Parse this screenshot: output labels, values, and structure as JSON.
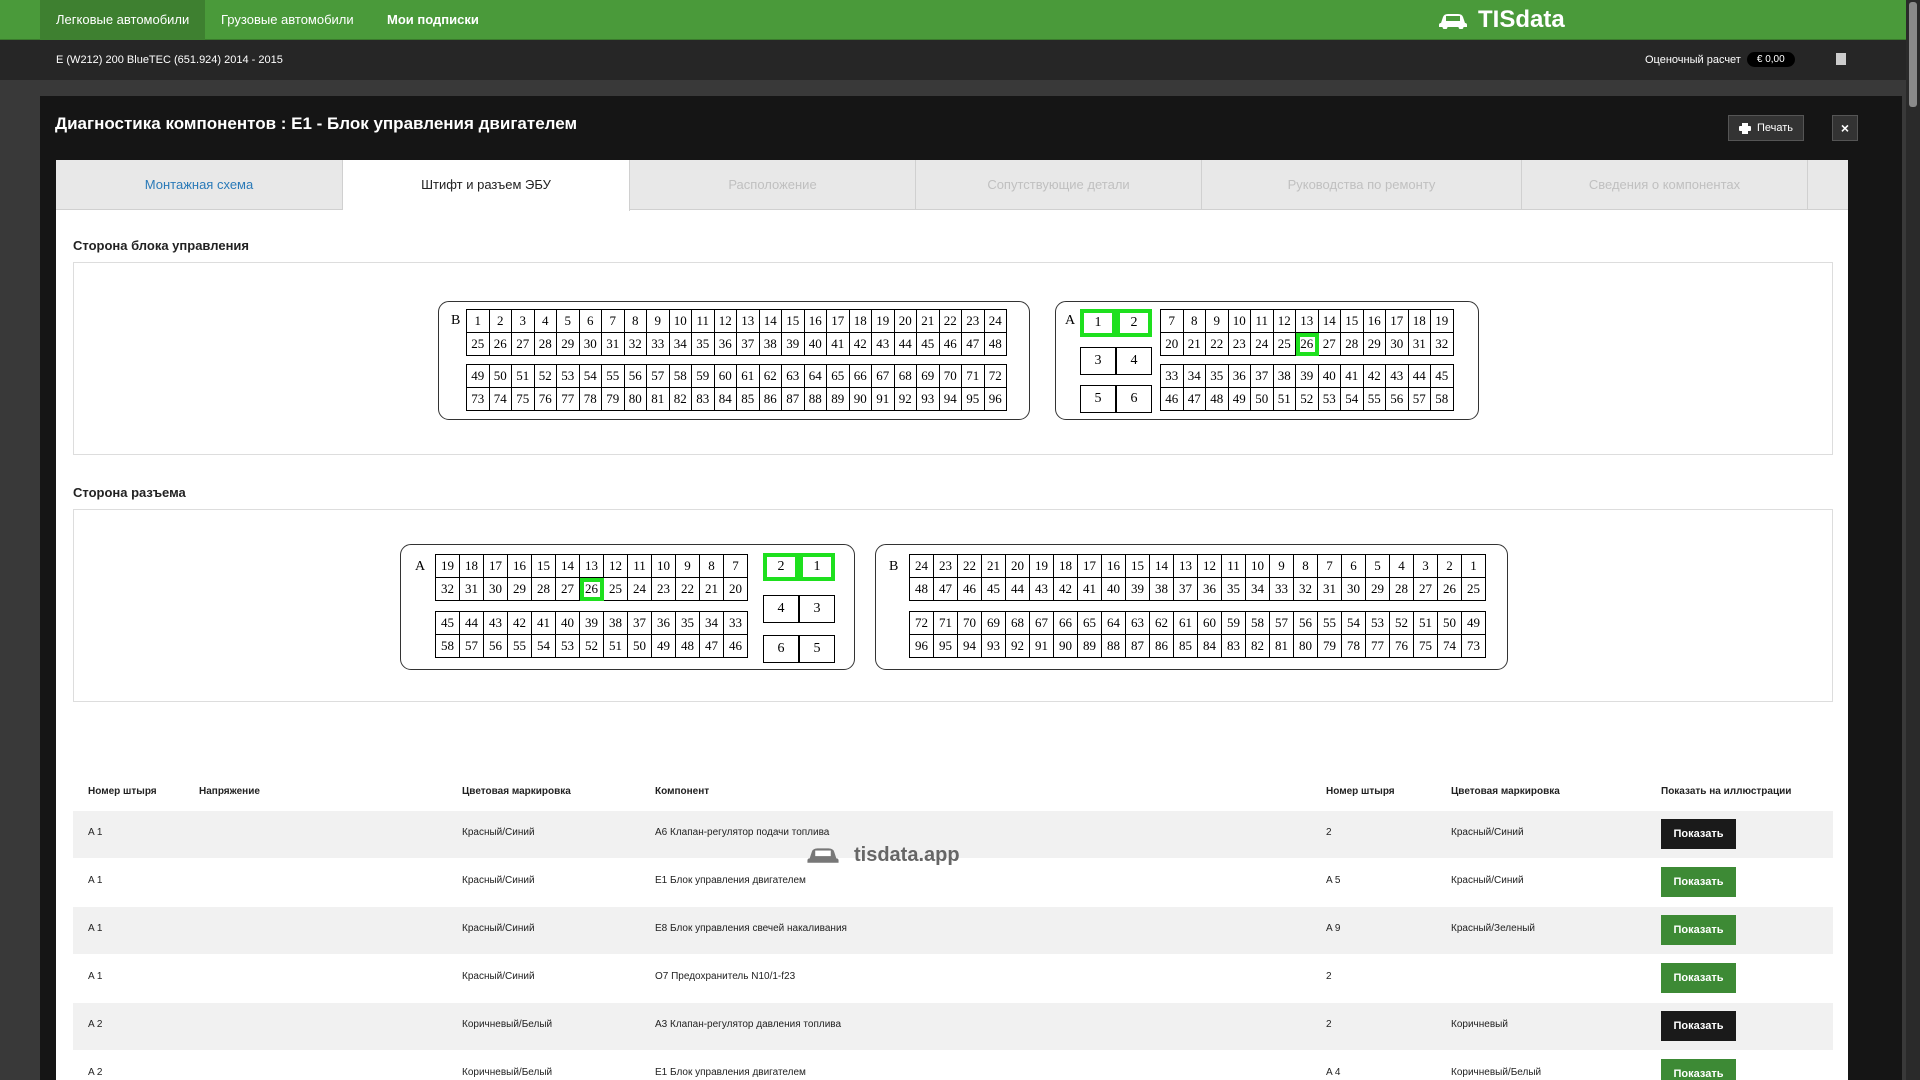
{
  "topnav": {
    "items": [
      {
        "label": "Легковые автомобили",
        "active": true
      },
      {
        "label": "Грузовые автомобили",
        "active": false
      },
      {
        "label": "Мои подписки",
        "active": false
      }
    ],
    "brand": "TISdata",
    "brand_icon": "car-icon"
  },
  "subbar": {
    "vehicle": "E (W212) 200 BlueTEC (651.924) 2014 - 2015",
    "estimate_label": "Оценочный расчет",
    "estimate_value": "€  0,00",
    "cart_icon": "clipboard-icon"
  },
  "modal": {
    "title": "Диагностика компонентов : E1 - Блок управления двигателем",
    "print_label": "Печать",
    "close_label": "×"
  },
  "tabs": [
    {
      "label": "Монтажная схема",
      "state": "link"
    },
    {
      "label": "Штифт и разъем ЭБУ",
      "state": "active"
    },
    {
      "label": "Расположение",
      "state": "disabled"
    },
    {
      "label": "Сопутствующие детали",
      "state": "disabled"
    },
    {
      "label": "Руководства по ремонту",
      "state": "disabled"
    },
    {
      "label": "Сведения о компонентах",
      "state": "disabled"
    }
  ],
  "highlight_color": "#1ee01e",
  "control_side": {
    "title": "Сторона блока управления",
    "connector_b": {
      "letter": "B",
      "rows": [
        [
          1,
          2,
          3,
          4,
          5,
          6,
          7,
          8,
          9,
          10,
          11,
          12,
          13,
          14,
          15,
          16,
          17,
          18,
          19,
          20,
          21,
          22,
          23,
          24
        ],
        [
          25,
          26,
          27,
          28,
          29,
          30,
          31,
          32,
          33,
          34,
          35,
          36,
          37,
          38,
          39,
          40,
          41,
          42,
          43,
          44,
          45,
          46,
          47,
          48
        ],
        [
          49,
          50,
          51,
          52,
          53,
          54,
          55,
          56,
          57,
          58,
          59,
          60,
          61,
          62,
          63,
          64,
          65,
          66,
          67,
          68,
          69,
          70,
          71,
          72
        ],
        [
          73,
          74,
          75,
          76,
          77,
          78,
          79,
          80,
          81,
          82,
          83,
          84,
          85,
          86,
          87,
          88,
          89,
          90,
          91,
          92,
          93,
          94,
          95,
          96
        ]
      ]
    },
    "connector_a": {
      "letter": "A",
      "big_pins": [
        {
          "label": "1",
          "highlight": true
        },
        {
          "label": "2",
          "highlight": true
        },
        {
          "label": "3",
          "highlight": false
        },
        {
          "label": "4",
          "highlight": false
        },
        {
          "label": "5",
          "highlight": false
        },
        {
          "label": "6",
          "highlight": false
        }
      ],
      "rows": [
        [
          7,
          8,
          9,
          10,
          11,
          12,
          13,
          14,
          15,
          16,
          17,
          18,
          19
        ],
        [
          20,
          21,
          22,
          23,
          24,
          25,
          26,
          27,
          28,
          29,
          30,
          31,
          32
        ],
        [
          33,
          34,
          35,
          36,
          37,
          38,
          39,
          40,
          41,
          42,
          43,
          44,
          45
        ],
        [
          46,
          47,
          48,
          49,
          50,
          51,
          52,
          53,
          54,
          55,
          56,
          57,
          58
        ]
      ],
      "highlighted": [
        26
      ]
    }
  },
  "connector_side": {
    "title": "Сторона разъема",
    "connector_a": {
      "letter": "A",
      "rows": [
        [
          19,
          18,
          17,
          16,
          15,
          14,
          13,
          12,
          11,
          10,
          9,
          8,
          7
        ],
        [
          32,
          31,
          30,
          29,
          28,
          27,
          26,
          25,
          24,
          23,
          22,
          21,
          20
        ],
        [
          45,
          44,
          43,
          42,
          41,
          40,
          39,
          38,
          37,
          36,
          35,
          34,
          33
        ],
        [
          58,
          57,
          56,
          55,
          54,
          53,
          52,
          51,
          50,
          49,
          48,
          47,
          46
        ]
      ],
      "big_pins": [
        {
          "label": "2",
          "highlight": true
        },
        {
          "label": "1",
          "highlight": true
        },
        {
          "label": "4",
          "highlight": false
        },
        {
          "label": "3",
          "highlight": false
        },
        {
          "label": "6",
          "highlight": false
        },
        {
          "label": "5",
          "highlight": false
        }
      ],
      "highlighted": [
        26
      ]
    },
    "connector_b": {
      "letter": "B",
      "rows": [
        [
          24,
          23,
          22,
          21,
          20,
          19,
          18,
          17,
          16,
          15,
          14,
          13,
          12,
          11,
          10,
          9,
          8,
          7,
          6,
          5,
          4,
          3,
          2,
          1
        ],
        [
          48,
          47,
          46,
          45,
          44,
          43,
          42,
          41,
          40,
          39,
          38,
          37,
          36,
          35,
          34,
          33,
          32,
          31,
          30,
          29,
          28,
          27,
          26,
          25
        ],
        [
          72,
          71,
          70,
          69,
          68,
          67,
          66,
          65,
          64,
          63,
          62,
          61,
          60,
          59,
          58,
          57,
          56,
          55,
          54,
          53,
          52,
          51,
          50,
          49
        ],
        [
          96,
          95,
          94,
          93,
          92,
          91,
          90,
          89,
          88,
          87,
          86,
          85,
          84,
          83,
          82,
          81,
          80,
          79,
          78,
          77,
          76,
          75,
          74,
          73
        ]
      ]
    }
  },
  "table": {
    "headers": [
      "Номер штыря",
      "Напряжение",
      "Цветовая маркировка",
      "Компонент",
      "Номер штыря",
      "Цветовая маркировка",
      "Показать на иллюстрации"
    ],
    "rows": [
      {
        "pin": "A 1",
        "voltage": "",
        "color": "Красный/Синий",
        "component": "A6 Клапан-регулятор подачи топлива",
        "pin2": "2",
        "color2": "Красный/Синий",
        "button": "Показать",
        "button_style": "dark"
      },
      {
        "pin": "A 1",
        "voltage": "",
        "color": "Красный/Синий",
        "component": "E1 Блок управления двигателем",
        "pin2": "A 5",
        "color2": "Красный/Синий",
        "button": "Показать",
        "button_style": "green"
      },
      {
        "pin": "A 1",
        "voltage": "",
        "color": "Красный/Синий",
        "component": "E8 Блок управления свечей накаливания",
        "pin2": "A 9",
        "color2": "Красный/Зеленый",
        "button": "Показать",
        "button_style": "green"
      },
      {
        "pin": "A 1",
        "voltage": "",
        "color": "Красный/Синий",
        "component": "O7 Предохранитель N10/1-f23",
        "pin2": "2",
        "color2": "",
        "button": "Показать",
        "button_style": "green"
      },
      {
        "pin": "A 2",
        "voltage": "",
        "color": "Коричневый/Белый",
        "component": "A3 Клапан-регулятор давления топлива",
        "pin2": "2",
        "color2": "Коричневый",
        "button": "Показать",
        "button_style": "dark"
      },
      {
        "pin": "A 2",
        "voltage": "",
        "color": "Коричневый/Белый",
        "component": "E1 Блок управления двигателем",
        "pin2": "A 4",
        "color2": "Коричневый/Белый",
        "button": "Показать",
        "button_style": "green"
      }
    ]
  },
  "watermark": {
    "text": "tisdata.app",
    "icon": "car-icon"
  }
}
